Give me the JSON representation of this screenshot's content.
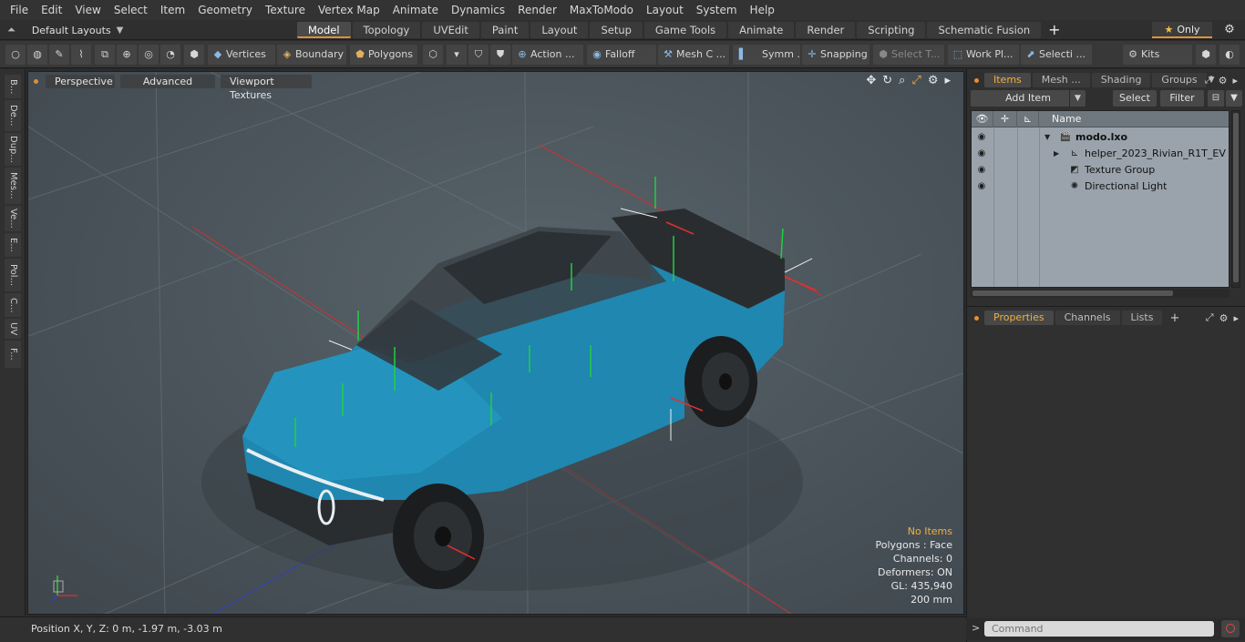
{
  "menu": [
    "File",
    "Edit",
    "View",
    "Select",
    "Item",
    "Geometry",
    "Texture",
    "Vertex Map",
    "Animate",
    "Dynamics",
    "Render",
    "MaxToModo",
    "Layout",
    "System",
    "Help"
  ],
  "layouts": {
    "label": "Default Layouts"
  },
  "tabs": [
    "Model",
    "Topology",
    "UVEdit",
    "Paint",
    "Layout",
    "Setup",
    "Game Tools",
    "Animate",
    "Render",
    "Scripting",
    "Schematic Fusion"
  ],
  "active_tab": "Model",
  "only_label": "Only",
  "toolbar": {
    "vertices": "Vertices",
    "boundary": "Boundary",
    "polygons": "Polygons",
    "action": "Action ...",
    "falloff": "Falloff",
    "mesh": "Mesh C ...",
    "symm": "Symm ...",
    "snapping": "Snapping",
    "select_t": "Select T...",
    "work_pl": "Work Pl...",
    "selecti": "Selecti ...",
    "kits": "Kits"
  },
  "left_tabs": [
    "B...",
    "De...",
    "Dup...",
    "Mes...",
    "Ve...",
    "E...",
    "Pol...",
    "C...",
    "UV",
    "F..."
  ],
  "viewport": {
    "perspective": "Perspective",
    "advanced": "Advanced",
    "viewport_textures": "Viewport Textures"
  },
  "hud": {
    "no_items": "No Items",
    "polygons": "Polygons : Face",
    "channels": "Channels: 0",
    "deformers": "Deformers: ON",
    "gl": "GL: 435,940",
    "scale": "200 mm"
  },
  "status": {
    "position": "Position X, Y, Z:   0 m, -1.97 m, -3.03 m"
  },
  "items_panel": {
    "tabs": [
      "Items",
      "Mesh ...",
      "Shading",
      "Groups"
    ],
    "add_item": "Add Item",
    "select": "Select",
    "filter": "Filter",
    "name_header": "Name",
    "rows": [
      {
        "label": "modo.lxo",
        "bold": true
      },
      {
        "label": "helper_2023_Rivian_R1T_EV ...",
        "bold": false
      },
      {
        "label": "Texture Group",
        "bold": false
      },
      {
        "label": "Directional Light",
        "bold": false
      }
    ]
  },
  "props_panel": {
    "tabs": [
      "Properties",
      "Channels",
      "Lists"
    ]
  },
  "command": {
    "placeholder": "Command"
  },
  "colors": {
    "accent": "#e0903a",
    "truck_body": "#1f87b0",
    "viewport_bg": "#4c555b"
  }
}
